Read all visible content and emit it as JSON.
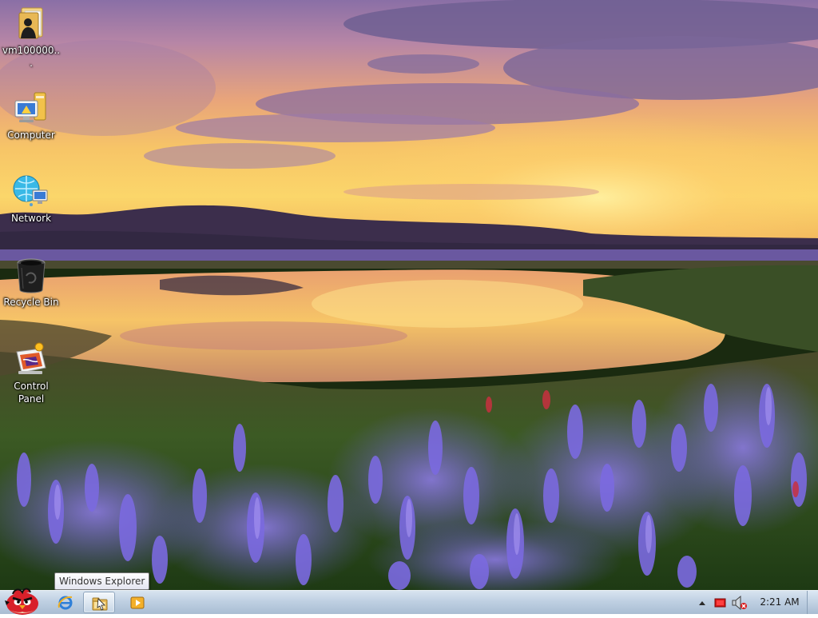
{
  "desktop": {
    "icons": [
      {
        "label": "vm100000...",
        "icon": "user-folder-icon"
      },
      {
        "label": "Computer",
        "icon": "computer-icon"
      },
      {
        "label": "Network",
        "icon": "network-icon"
      },
      {
        "label": "Recycle Bin",
        "icon": "recycle-bin-icon"
      },
      {
        "label": "Control Panel",
        "icon": "control-panel-icon"
      }
    ]
  },
  "tooltip": {
    "text": "Windows Explorer"
  },
  "taskbar": {
    "start_icon": "angry-bird-start-icon",
    "pinned": [
      {
        "name": "Internet Explorer",
        "icon": "internet-explorer-icon"
      },
      {
        "name": "Windows Explorer",
        "icon": "windows-explorer-icon",
        "active": true
      },
      {
        "name": "Windows Media Player",
        "icon": "media-player-icon"
      }
    ],
    "tray": {
      "icons": [
        "show-hidden-icons-arrow",
        "action-center-flag-icon",
        "volume-muted-icon"
      ],
      "time": "2:21 AM"
    }
  },
  "colors": {
    "taskbar_top": "#d8e4f0",
    "taskbar_bottom": "#a9bdd3",
    "icon_label": "#ffffff"
  }
}
